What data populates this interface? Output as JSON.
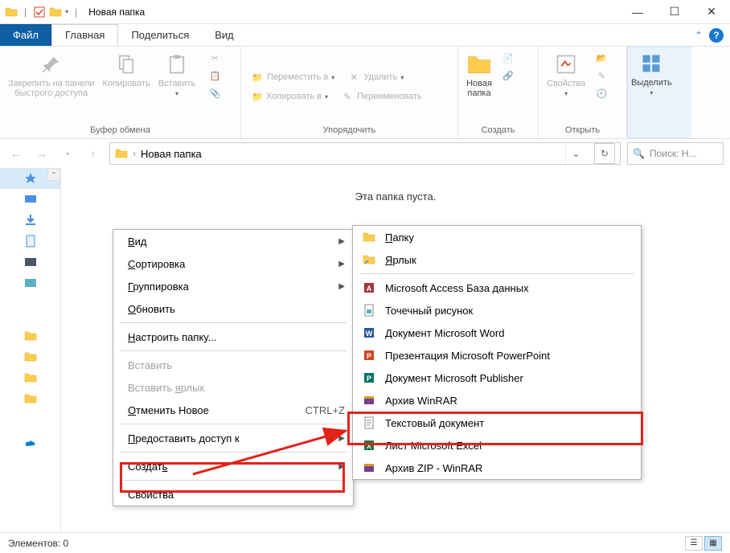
{
  "titlebar": {
    "title": "Новая папка",
    "sep": "|"
  },
  "tabs": {
    "file": "Файл",
    "home": "Главная",
    "share": "Поделиться",
    "view": "Вид"
  },
  "ribbon": {
    "pin": "Закрепить на панели\nбыстрого доступа",
    "copy": "Копировать",
    "paste": "Вставить",
    "clipboard_label": "Буфер обмена",
    "move_to": "Переместить в",
    "copy_to": "Копировать в",
    "delete": "Удалить",
    "rename": "Переименовать",
    "organize_label": "Упорядочить",
    "new_folder": "Новая\nпапка",
    "create_label": "Создать",
    "properties": "Свойства",
    "open_label": "Открыть",
    "select": "Выделить"
  },
  "address": {
    "crumb": "Новая папка"
  },
  "search": {
    "placeholder": "Поиск: Н..."
  },
  "content": {
    "empty": "Эта папка пуста."
  },
  "status": {
    "elements": "Элементов: 0"
  },
  "ctx_main": {
    "view": "Вид",
    "sort": "Сортировка",
    "group": "Группировка",
    "refresh": "Обновить",
    "customize": "Настроить папку...",
    "paste": "Вставить",
    "paste_shortcut": "Вставить ярлык",
    "undo": "Отменить Новое",
    "undo_key": "CTRL+Z",
    "give_access": "Предоставить доступ к",
    "create": "Создать",
    "properties": "Свойства"
  },
  "ctx_sub": {
    "folder": "Папку",
    "shortcut": "Ярлык",
    "access": "Microsoft Access База данных",
    "bitmap": "Точечный рисунок",
    "word": "Документ Microsoft Word",
    "ppt": "Презентация Microsoft PowerPoint",
    "publisher": "Документ Microsoft Publisher",
    "winrar": "Архив WinRAR",
    "text": "Текстовый документ",
    "excel": "Лист Microsoft Excel",
    "zip": "Архив ZIP - WinRAR"
  }
}
